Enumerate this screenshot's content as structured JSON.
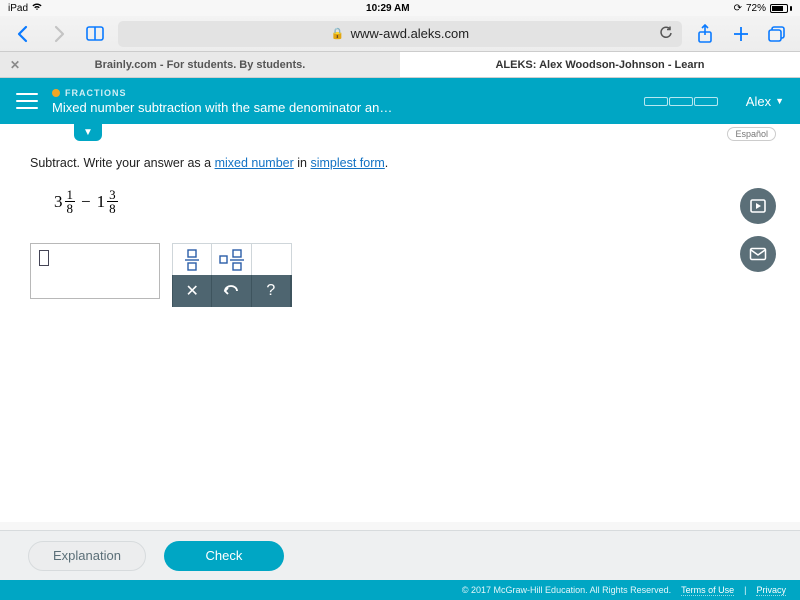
{
  "status": {
    "device": "iPad",
    "time": "10:29 AM",
    "battery": "72%"
  },
  "safari": {
    "url": "www-awd.aleks.com"
  },
  "tabs": {
    "inactive": "Brainly.com - For students. By students.",
    "active": "ALEKS: Alex Woodson-Johnson - Learn"
  },
  "header": {
    "category": "FRACTIONS",
    "title": "Mixed number subtraction with the same denominator an…",
    "user": "Alex"
  },
  "lang": "Español",
  "prompt": {
    "pre": "Subtract. Write your answer as a ",
    "link1": "mixed number",
    "mid": " in ",
    "link2": "simplest form",
    "post": "."
  },
  "expression": {
    "a_whole": "3",
    "a_num": "1",
    "a_den": "8",
    "op": "−",
    "b_whole": "1",
    "b_num": "3",
    "b_den": "8"
  },
  "buttons": {
    "explanation": "Explanation",
    "check": "Check",
    "help": "?"
  },
  "footer": {
    "copyright": "© 2017 McGraw-Hill Education. All Rights Reserved.",
    "terms": "Terms of Use",
    "privacy": "Privacy"
  }
}
